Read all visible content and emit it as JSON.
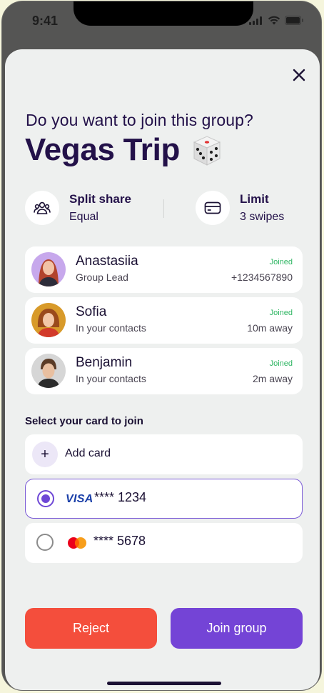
{
  "status_bar": {
    "time": "9:41"
  },
  "sheet": {
    "question": "Do you want to join this group?",
    "group_name": "Vegas Trip",
    "stats": {
      "split": {
        "label": "Split share",
        "value": "Equal",
        "icon": "people-icon"
      },
      "limit": {
        "label": "Limit",
        "value": "3 swipes",
        "icon": "card-icon"
      }
    },
    "members": [
      {
        "name": "Anastasiia",
        "role": "Group Lead",
        "status": "Joined",
        "detail": "+1234567890"
      },
      {
        "name": "Sofia",
        "role": "In your contacts",
        "status": "Joined",
        "detail": "10m away"
      },
      {
        "name": "Benjamin",
        "role": "In your contacts",
        "status": "Joined",
        "detail": "2m away"
      }
    ],
    "card_section_title": "Select your card to join",
    "add_card_label": "Add card",
    "add_card_icon": "+",
    "cards": [
      {
        "brand": "VISA",
        "number": "**** 1234",
        "selected": true
      },
      {
        "brand": "mastercard",
        "number": "**** 5678",
        "selected": false
      }
    ],
    "reject_label": "Reject",
    "join_label": "Join group"
  },
  "colors": {
    "accent": "#7444d6",
    "reject": "#f44e3c",
    "joined": "#2db562",
    "title": "#231149"
  }
}
